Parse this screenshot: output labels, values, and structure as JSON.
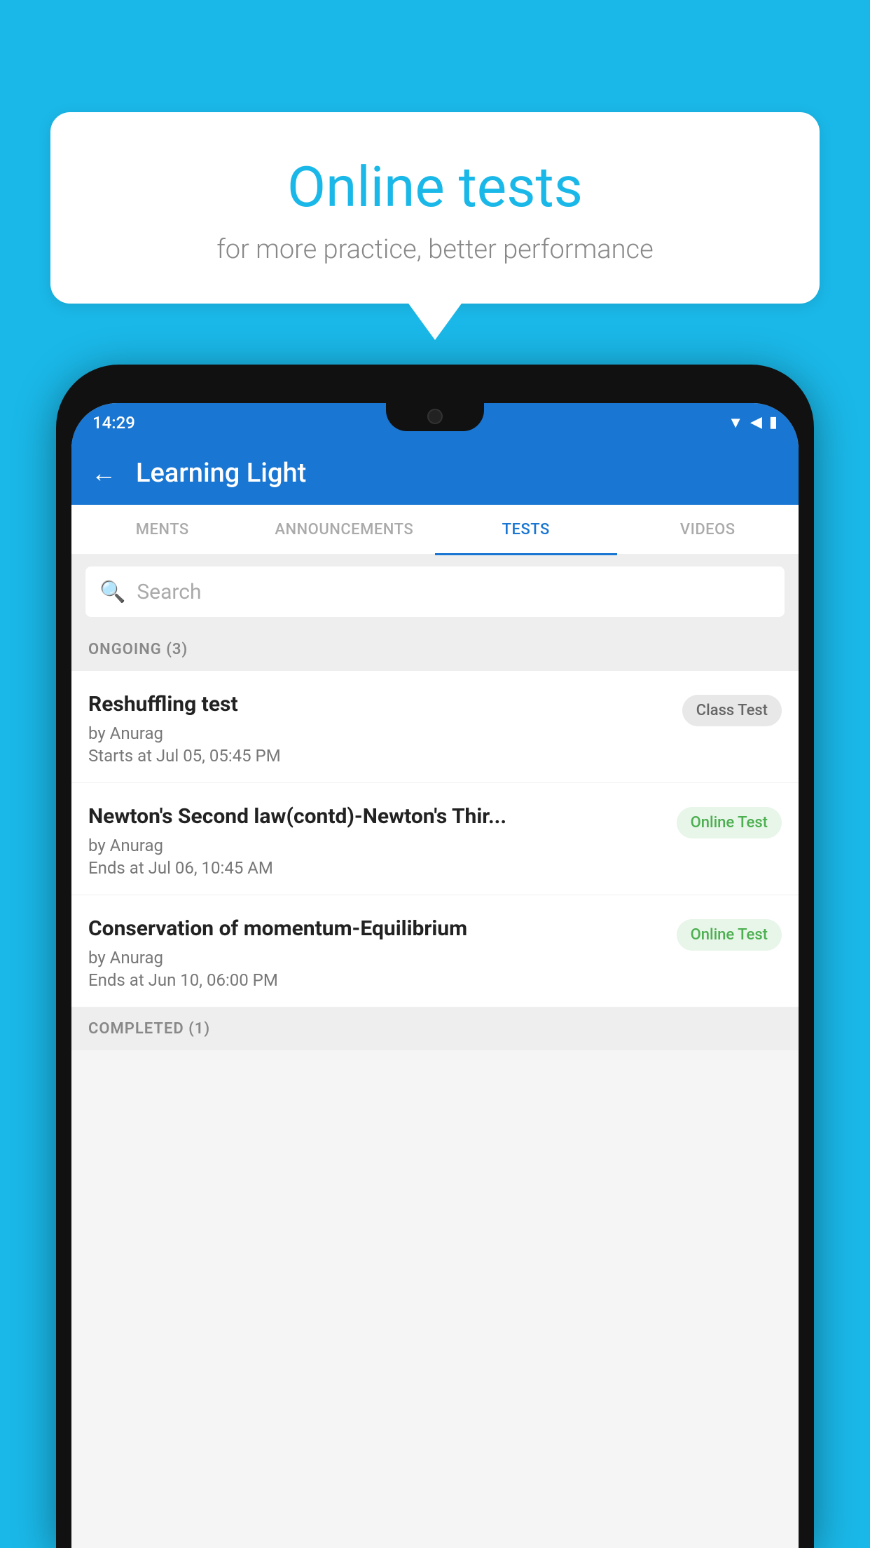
{
  "background_color": "#1ab8e8",
  "bubble": {
    "title": "Online tests",
    "subtitle": "for more practice, better performance"
  },
  "status_bar": {
    "time": "14:29",
    "icons": [
      "wifi",
      "signal",
      "battery"
    ]
  },
  "header": {
    "title": "Learning Light",
    "back_label": "←"
  },
  "tabs": [
    {
      "label": "MENTS",
      "active": false
    },
    {
      "label": "ANNOUNCEMENTS",
      "active": false
    },
    {
      "label": "TESTS",
      "active": true
    },
    {
      "label": "VIDEOS",
      "active": false
    }
  ],
  "search": {
    "placeholder": "Search"
  },
  "ongoing_section": {
    "label": "ONGOING (3)"
  },
  "tests": [
    {
      "title": "Reshuffling test",
      "author": "by Anurag",
      "date": "Starts at  Jul 05, 05:45 PM",
      "badge": "Class Test",
      "badge_type": "class"
    },
    {
      "title": "Newton's Second law(contd)-Newton's Thir...",
      "author": "by Anurag",
      "date": "Ends at  Jul 06, 10:45 AM",
      "badge": "Online Test",
      "badge_type": "online"
    },
    {
      "title": "Conservation of momentum-Equilibrium",
      "author": "by Anurag",
      "date": "Ends at  Jun 10, 06:00 PM",
      "badge": "Online Test",
      "badge_type": "online"
    }
  ],
  "completed_section": {
    "label": "COMPLETED (1)"
  }
}
